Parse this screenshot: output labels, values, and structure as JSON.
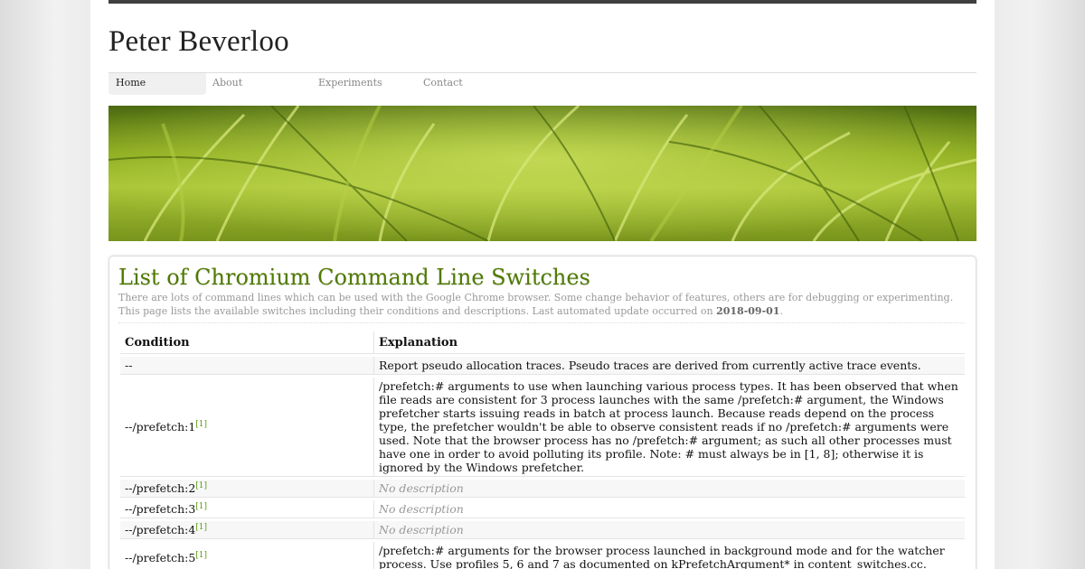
{
  "site": {
    "title": "Peter Beverloo"
  },
  "nav": [
    {
      "label": "Home",
      "active": true
    },
    {
      "label": "About",
      "active": false
    },
    {
      "label": "Experiments",
      "active": false
    },
    {
      "label": "Contact",
      "active": false
    }
  ],
  "banner": {
    "description_icon": "grass-banner-image",
    "accent": "#8fb21f"
  },
  "main": {
    "heading": "List of Chromium Command Line Switches",
    "intro_text": "There are lots of command lines which can be used with the Google Chrome browser. Some change behavior of features, others are for debugging or experimenting. This page lists the available switches including their conditions and descriptions. Last automated update occurred on ",
    "updated_date": "2018-09-01",
    "intro_end": "."
  },
  "table": {
    "headers": {
      "condition": "Condition",
      "explanation": "Explanation"
    },
    "rows": [
      {
        "condition": "--",
        "ref": "",
        "explanation": "Report pseudo allocation traces. Pseudo traces are derived from currently active trace events.",
        "no_description": false
      },
      {
        "condition": "--/prefetch:1",
        "ref": "[1]",
        "explanation": "/prefetch:# arguments to use when launching various process types. It has been observed that when file reads are consistent for 3 process launches with the same /prefetch:# argument, the Windows prefetcher starts issuing reads in batch at process launch. Because reads depend on the process type, the prefetcher wouldn't be able to observe consistent reads if no /prefetch:# arguments were used. Note that the browser process has no /prefetch:# argument; as such all other processes must have one in order to avoid polluting its profile. Note: # must always be in [1, 8]; otherwise it is ignored by the Windows prefetcher.",
        "no_description": false
      },
      {
        "condition": "--/prefetch:2",
        "ref": "[1]",
        "explanation": "No description",
        "no_description": true
      },
      {
        "condition": "--/prefetch:3",
        "ref": "[1]",
        "explanation": "No description",
        "no_description": true
      },
      {
        "condition": "--/prefetch:4",
        "ref": "[1]",
        "explanation": "No description",
        "no_description": true
      },
      {
        "condition": "--/prefetch:5",
        "ref": "[1]",
        "explanation": "/prefetch:# arguments for the browser process launched in background mode and for the watcher process. Use profiles 5, 6 and 7 as documented on kPrefetchArgument* in content_switches.cc.",
        "no_description": false
      }
    ]
  },
  "colors": {
    "heading": "#4f7a00",
    "ref_link": "#5a9a10",
    "topbar": "#3f3f3f"
  }
}
